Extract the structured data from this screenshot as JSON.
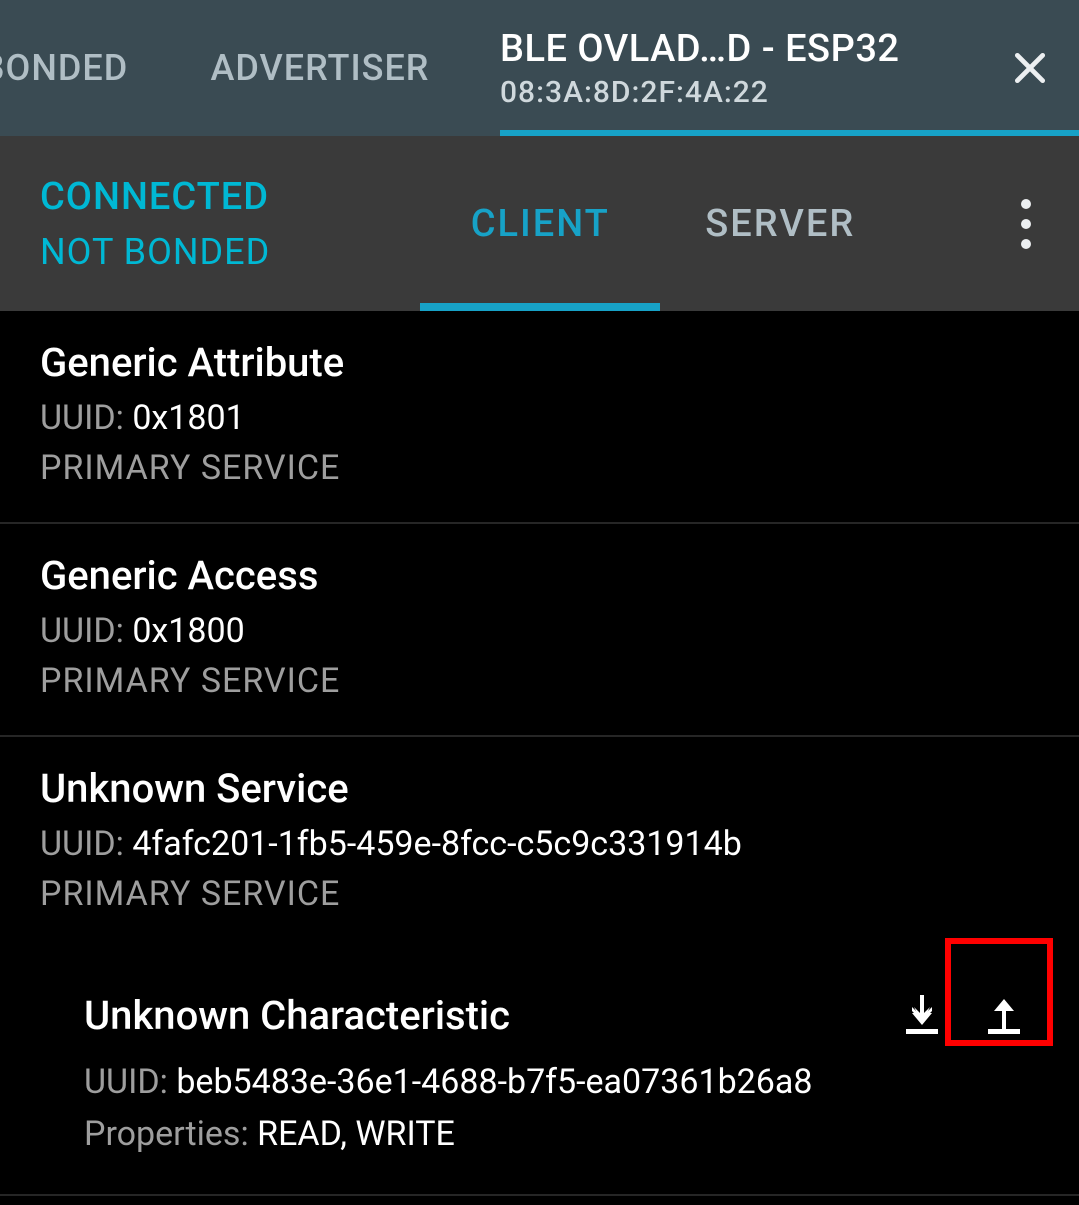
{
  "toptabs": {
    "bonded_label": "BONDED",
    "advertiser_label": "ADVERTISER",
    "device_name": "BLE OVLAD…D - ESP32",
    "device_mac": "08:3A:8D:2F:4A:22"
  },
  "status": {
    "connection_label": "CONNECTED",
    "bond_label": "NOT BONDED",
    "subtab_client": "CLIENT",
    "subtab_server": "SERVER"
  },
  "labels": {
    "uuid_prefix": "UUID: ",
    "properties_prefix": "Properties: "
  },
  "services": [
    {
      "name": "Generic Attribute",
      "uuid": "0x1801",
      "type": "PRIMARY SERVICE"
    },
    {
      "name": "Generic Access",
      "uuid": "0x1800",
      "type": "PRIMARY SERVICE"
    },
    {
      "name": "Unknown Service",
      "uuid": "4fafc201-1fb5-459e-8fcc-c5c9c331914b",
      "type": "PRIMARY SERVICE",
      "characteristics": [
        {
          "name": "Unknown Characteristic",
          "uuid": "beb5483e-36e1-4688-b7f5-ea07361b26a8",
          "properties": "READ, WRITE"
        }
      ]
    }
  ]
}
